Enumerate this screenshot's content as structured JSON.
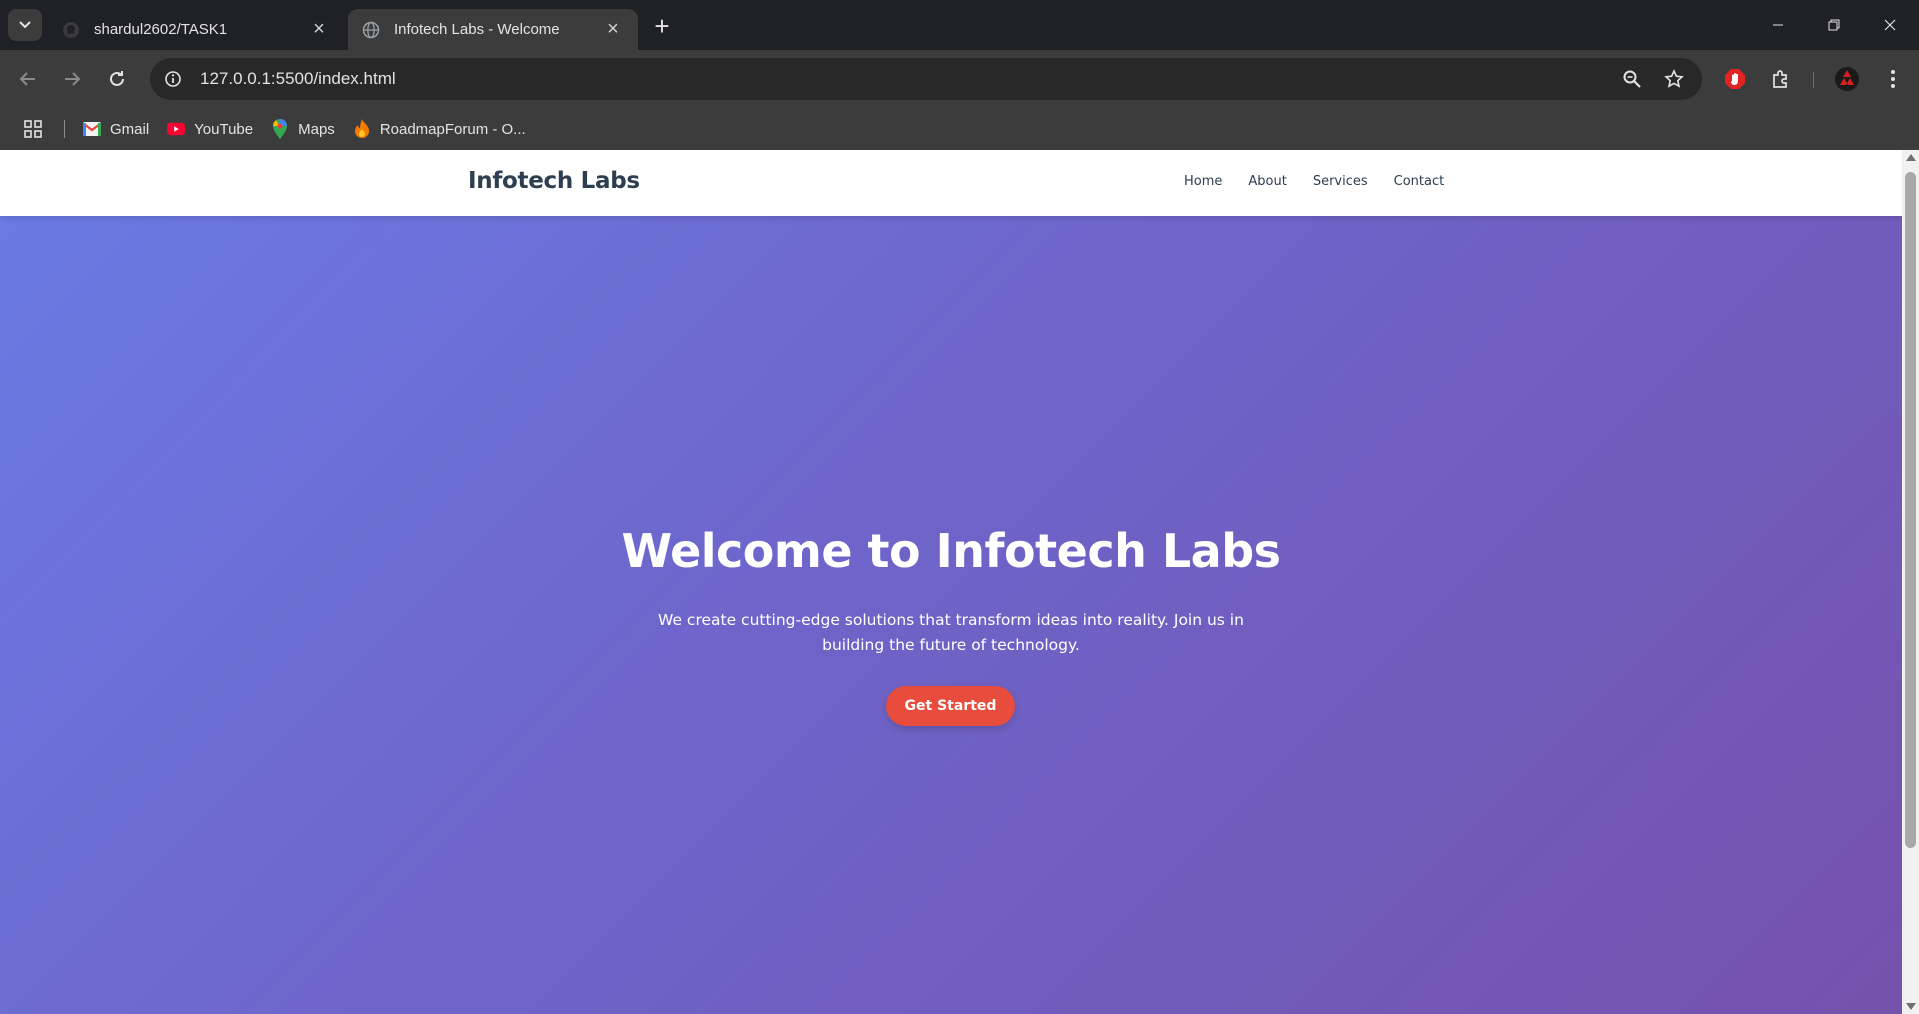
{
  "browser": {
    "tabs": [
      {
        "title": "shardul2602/TASK1",
        "icon": "github-icon",
        "active": false
      },
      {
        "title": "Infotech Labs - Welcome",
        "icon": "globe-icon",
        "active": true
      }
    ],
    "url": "127.0.0.1:5500/index.html",
    "bookmarks": [
      {
        "label": "Gmail",
        "icon": "gmail-icon"
      },
      {
        "label": "YouTube",
        "icon": "youtube-icon"
      },
      {
        "label": "Maps",
        "icon": "maps-icon"
      },
      {
        "label": "RoadmapForum - O...",
        "icon": "fire-icon"
      }
    ]
  },
  "site": {
    "logo": "Infotech Labs",
    "nav": [
      "Home",
      "About",
      "Services",
      "Contact"
    ],
    "hero": {
      "title": "Welcome to Infotech Labs",
      "subtitle": "We create cutting-edge solutions that transform ideas into reality. Join us in building the future of technology.",
      "cta": "Get Started"
    }
  },
  "colors": {
    "hero_gradient_start": "#6a7ae3",
    "hero_gradient_end": "#7552ac",
    "cta_background": "#e74c3c",
    "logo_text": "#2c3e50"
  }
}
